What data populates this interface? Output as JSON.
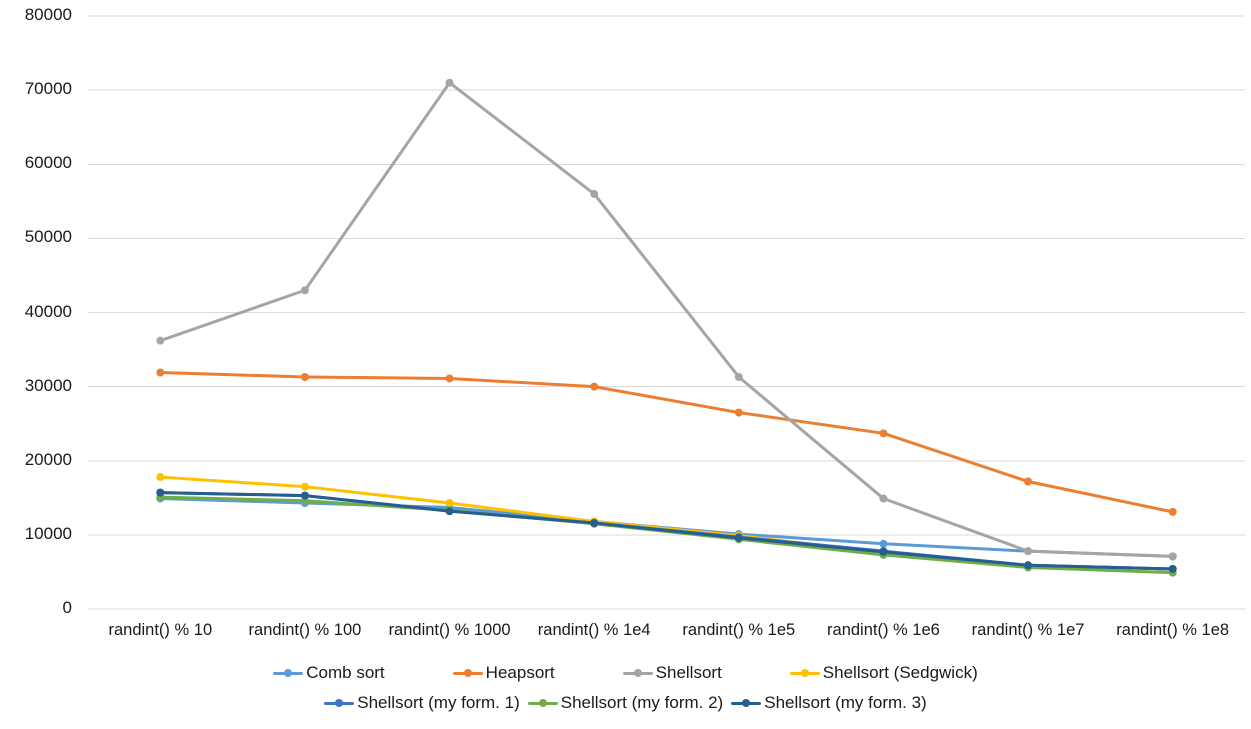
{
  "chart_data": {
    "type": "line",
    "title": "",
    "xlabel": "",
    "ylabel": "",
    "ylim": [
      0,
      80000
    ],
    "ytick_values": [
      0,
      10000,
      20000,
      30000,
      40000,
      50000,
      60000,
      70000,
      80000
    ],
    "ytick_labels": [
      "0",
      "10000",
      "20000",
      "30000",
      "40000",
      "50000",
      "60000",
      "70000",
      "80000"
    ],
    "grid": true,
    "legend_position": "bottom",
    "categories": [
      "randint() % 10",
      "randint() % 100",
      "randint() % 1000",
      "randint() % 1e4",
      "randint() % 1e5",
      "randint() % 1e6",
      "randint() % 1e7",
      "randint() % 1e8"
    ],
    "series": [
      {
        "name": "Comb sort",
        "color": "#5B9BD5",
        "values": [
          14900,
          14300,
          13700,
          11800,
          10100,
          8800,
          7800,
          7100
        ]
      },
      {
        "name": "Heapsort",
        "color": "#ED7D31",
        "values": [
          31900,
          31300,
          31100,
          30000,
          26500,
          23700,
          17200,
          13100
        ]
      },
      {
        "name": "Shellsort",
        "color": "#A5A5A5",
        "values": [
          36200,
          43000,
          71000,
          56000,
          31300,
          14900,
          7800,
          7100
        ]
      },
      {
        "name": "Shellsort (Sedgwick)",
        "color": "#FFC000",
        "values": [
          17800,
          16500,
          14300,
          11800,
          9900,
          7600,
          5900,
          5400
        ]
      },
      {
        "name": "Shellsort (my form. 1)",
        "color": "#4472C4",
        "values": [
          15700,
          15300,
          13200,
          11600,
          9700,
          7800,
          5900,
          5400
        ]
      },
      {
        "name": "Shellsort (my form. 2)",
        "color": "#70AD47",
        "values": [
          15100,
          14600,
          13300,
          11500,
          9400,
          7300,
          5600,
          4900
        ]
      },
      {
        "name": "Shellsort (my form. 3)",
        "color": "#255E91",
        "values": [
          15700,
          15300,
          13200,
          11600,
          9600,
          7700,
          5900,
          5400
        ]
      }
    ]
  }
}
